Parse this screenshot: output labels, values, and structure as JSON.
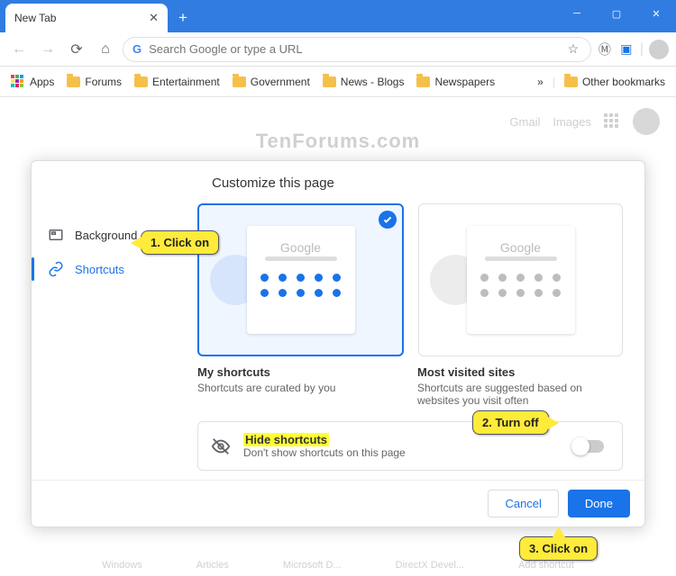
{
  "window": {
    "tab_title": "New Tab"
  },
  "toolbar": {
    "placeholder": "Search Google or type a URL"
  },
  "bookmarks": {
    "apps": "Apps",
    "items": [
      "Forums",
      "Entertainment",
      "Government",
      "News - Blogs",
      "Newspapers"
    ],
    "overflow": "»",
    "other": "Other bookmarks"
  },
  "ntp": {
    "gmail": "Gmail",
    "images": "Images",
    "watermark": "TenForums.com",
    "shortcuts": [
      "Windows",
      "Articles",
      "Microsoft D...",
      "DirectX Devel...",
      "Add shortcut"
    ]
  },
  "dialog": {
    "title": "Customize this page",
    "sidebar": {
      "background": "Background",
      "shortcuts": "Shortcuts"
    },
    "cards": {
      "my": {
        "title": "My shortcuts",
        "sub": "Shortcuts are curated by you",
        "logo": "Google"
      },
      "most": {
        "title": "Most visited sites",
        "sub": "Shortcuts are suggested based on websites you visit often",
        "logo": "Google"
      }
    },
    "hide": {
      "title": "Hide shortcuts",
      "sub": "Don't show shortcuts on this page"
    },
    "cancel": "Cancel",
    "done": "Done"
  },
  "callouts": {
    "c1": "1. Click on",
    "c2": "2. Turn off",
    "c3": "3. Click on"
  }
}
